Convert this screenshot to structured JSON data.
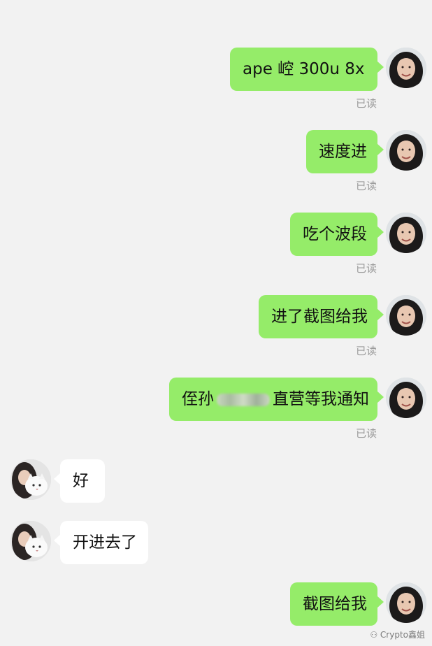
{
  "messages": [
    {
      "side": "out",
      "text": "ape 崆 300u  8x",
      "status": "已读"
    },
    {
      "side": "out",
      "text": "速度进",
      "status": "已读"
    },
    {
      "side": "out",
      "text": "吃个波段",
      "status": "已读"
    },
    {
      "side": "out",
      "text": "进了截图给我",
      "status": "已读"
    },
    {
      "side": "out",
      "text_before": "侄孙",
      "text_after": "直营等我通知",
      "status": "已读"
    },
    {
      "side": "in",
      "text": "好"
    },
    {
      "side": "in",
      "text": "开进去了"
    },
    {
      "side": "out",
      "text": "截图给我"
    }
  ],
  "watermark": "Crypto鑫姐",
  "colors": {
    "background": "#f2f2f2",
    "outgoing_bubble": "#95ec69",
    "incoming_bubble": "#ffffff",
    "read_status": "#9b9b9b"
  }
}
